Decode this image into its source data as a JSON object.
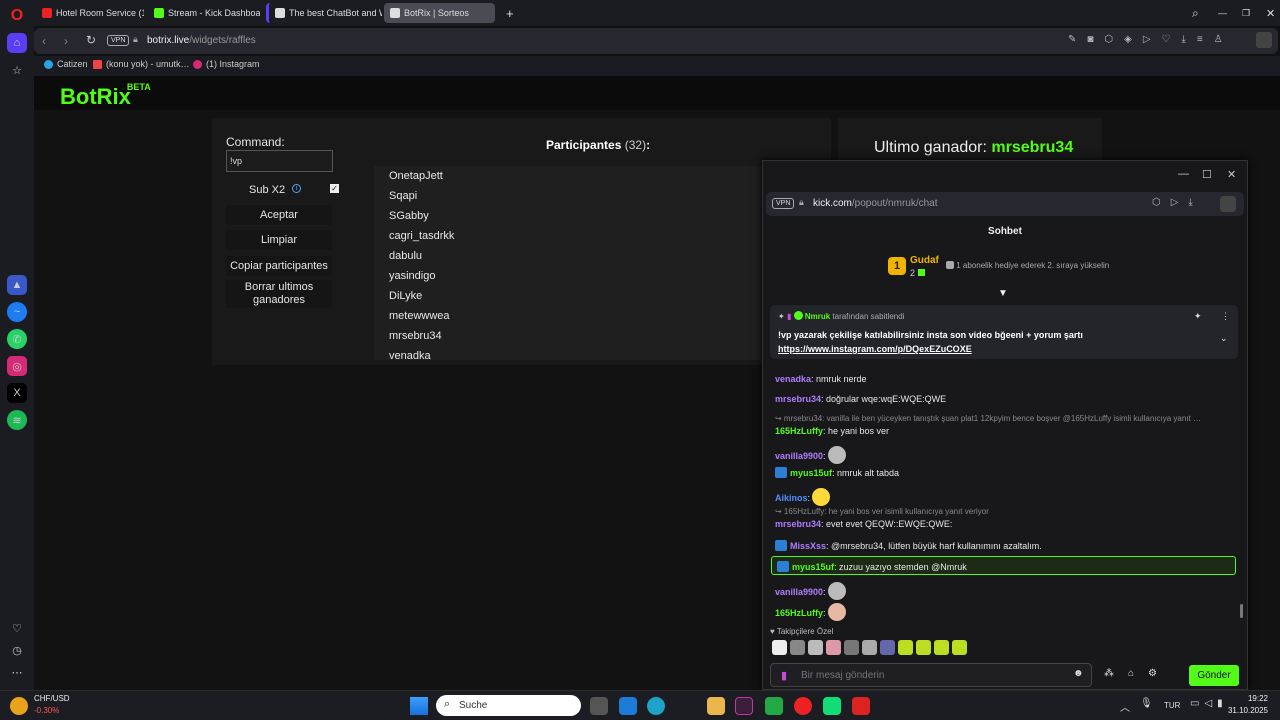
{
  "tabs": [
    {
      "label": "Hotel Room Service (1…",
      "color": "#e22"
    },
    {
      "label": "Stream - Kick Dashboard",
      "color": "#53fc18"
    },
    {
      "label": "The best ChatBot and Wi…",
      "color": "#ddd"
    },
    {
      "label": "BotRix | Sorteos",
      "color": "#ddd"
    }
  ],
  "address": {
    "vpn": "VPN",
    "host": "botrix.live",
    "path": "/widgets/raffles"
  },
  "bookmarks": [
    "Catizen",
    "(konu yok) - umutk…",
    "(1) Instagram"
  ],
  "brand": {
    "name": "BotRix",
    "tag": "BETA"
  },
  "form": {
    "command_label": "Command:",
    "command_value": "!vp",
    "sub_label": "Sub X2",
    "sub_checked": true,
    "accept": "Aceptar",
    "clear": "Limpiar",
    "copy": "Copiar participantes",
    "delete": "Borrar ultimos ganadores"
  },
  "participants": {
    "title": "Participantes",
    "count": "(32)",
    "colon": ":",
    "items": [
      "OnetapJett",
      "Sqapi",
      "SGabby",
      "cagri_tasdrkk",
      "dabulu",
      "yasindigo",
      "DiLyke",
      "metewwwea",
      "mrsebru34",
      "venadka"
    ]
  },
  "winner": {
    "label": "Ultimo ganador:",
    "name": "mrsebru34"
  },
  "popup": {
    "vpn": "VPN",
    "url_host": "kick.com",
    "url_path": "/popout/nmruk/chat",
    "title": "Sohbet",
    "leader": {
      "rank": "1",
      "name": "Gudaf",
      "count": "2",
      "text": "1 abonelik hediye ederek 2. sıraya yükselin"
    },
    "pinned": {
      "by": "Nmruk",
      "by_suffix": "tarafından sabitlendi",
      "text": "!vp yazarak çekilişe katılabilirsiniz insta son video bğeeni + yorum şartı",
      "link": "https://www.instagram.com/p/DQexEZuCOXE"
    },
    "messages": [
      {
        "user": "venadka",
        "color": "#b07cff",
        "text": ": nmruk nerde"
      },
      {
        "user": "mrsebru34",
        "color": "#b07cff",
        "text": ": doğrular wqe:wqE:WQE:QWE"
      },
      {
        "reply": "↪ mrsebru34: vanilla ile ben yüceyken tanıştık şuan plat1 12kpyim bence boşver @165HzLuffy isimli kullanıcıya yanıt …"
      },
      {
        "user": "165HzLuffy",
        "color": "#53fc18",
        "text": ": he yani bos ver"
      },
      {
        "user": "vanilla9900",
        "color": "#b07cff",
        "text": ":"
      },
      {
        "user": "myus15uf",
        "color": "#53fc18",
        "text": ": nmruk alt tabda",
        "badge": true
      },
      {
        "user": "Aikinos",
        "color": "#4f8fff",
        "text": ":"
      },
      {
        "reply": "↪ 165HzLuffy: he yani bos ver isimli kullanıcıya yanıt veriyor"
      },
      {
        "user": "mrsebru34",
        "color": "#b07cff",
        "text": ": evet evet QEQW::EWQE:QWE:"
      },
      {
        "user": "MissXss",
        "color": "#b07cff",
        "text": ": @mrsebru34, lütfen büyük harf kullanımını azaltalım.",
        "badge": true
      },
      {
        "user": "myus15uf",
        "color": "#53fc18",
        "text": ": zuzuu yazıyo stemden @Nmruk",
        "badge": true,
        "highlight": true
      },
      {
        "user": "vanilla9900",
        "color": "#b07cff",
        "text": ":"
      },
      {
        "user": "165HzLuffy",
        "color": "#53fc18",
        "text": ":"
      }
    ],
    "followers_label": "♥ Takipçilere Özel",
    "input_placeholder": "Bir mesaj gönderin",
    "send": "Gönder"
  },
  "taskbar": {
    "ticker": "CHF/USD",
    "change": "-0.30%",
    "search": "Suche",
    "lang": "TUR",
    "time": "19:22",
    "date": "31.10.2025"
  }
}
